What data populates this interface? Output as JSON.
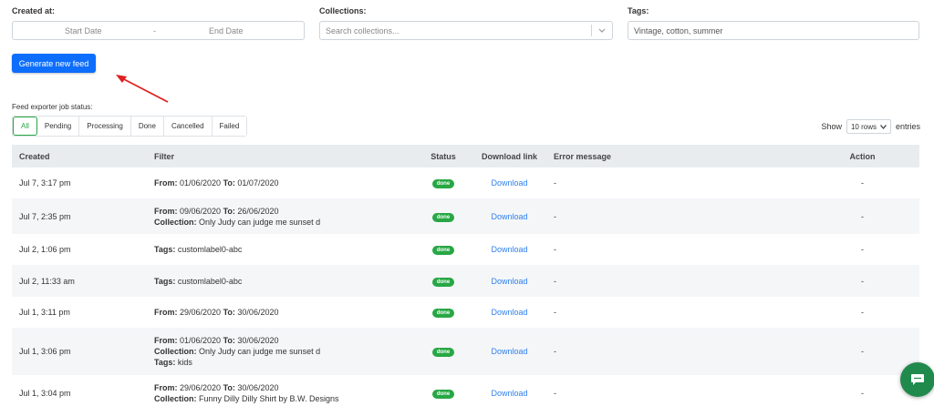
{
  "filters": {
    "created_label": "Created at:",
    "start_date": "Start Date",
    "date_sep": "-",
    "end_date": "End Date",
    "collections_label": "Collections:",
    "collections_placeholder": "Search collections...",
    "tags_label": "Tags:",
    "tags_placeholder": "Vintage, cotton, summer"
  },
  "generate_button": "Generate new feed",
  "status_label": "Feed exporter job status:",
  "tabs": [
    "All",
    "Pending",
    "Processing",
    "Done",
    "Cancelled",
    "Failed"
  ],
  "show": {
    "prefix": "Show",
    "value": "10 rows",
    "suffix": "entries"
  },
  "table": {
    "headers": [
      "Created",
      "Filter",
      "Status",
      "Download link",
      "Error message",
      "Action"
    ],
    "rows": [
      {
        "created": "Jul 7, 3:17 pm",
        "from": "01/06/2020",
        "to": "01/07/2020",
        "status": "done",
        "download": "Download",
        "error": "-",
        "action": "-"
      },
      {
        "created": "Jul 7, 2:35 pm",
        "from": "09/06/2020",
        "to": "26/06/2020",
        "collection": "Only Judy can judge me sunset d",
        "status": "done",
        "download": "Download",
        "error": "-",
        "action": "-"
      },
      {
        "created": "Jul 2, 1:06 pm",
        "tags": "customlabel0-abc",
        "status": "done",
        "download": "Download",
        "error": "-",
        "action": "-"
      },
      {
        "created": "Jul 2, 11:33 am",
        "tags": "customlabel0-abc",
        "status": "done",
        "download": "Download",
        "error": "-",
        "action": "-"
      },
      {
        "created": "Jul 1, 3:11 pm",
        "from": "29/06/2020",
        "to": "30/06/2020",
        "status": "done",
        "download": "Download",
        "error": "-",
        "action": "-"
      },
      {
        "created": "Jul 1, 3:06 pm",
        "from": "01/06/2020",
        "to": "30/06/2020",
        "collection": "Only Judy can judge me sunset d",
        "tags": "kids",
        "status": "done",
        "download": "Download",
        "error": "-",
        "action": "-"
      },
      {
        "created": "Jul 1, 3:04 pm",
        "from": "29/06/2020",
        "to": "30/06/2020",
        "collection": "Funny Dilly Dilly Shirt by B.W. Designs",
        "status": "done",
        "download": "Download",
        "error": "-",
        "action": "-"
      }
    ]
  },
  "filter_keys": {
    "from": "From:",
    "to": "To:",
    "collection": "Collection:",
    "tags": "Tags:"
  },
  "colors": {
    "primary": "#0d6efd",
    "success": "#28a745",
    "link": "#2f80ed",
    "annotation_arrow": "#e02020"
  },
  "icons": {
    "collections_dropdown": "chevron-down-icon",
    "show_dropdown": "chevron-down-icon",
    "chat": "chat-icon"
  }
}
